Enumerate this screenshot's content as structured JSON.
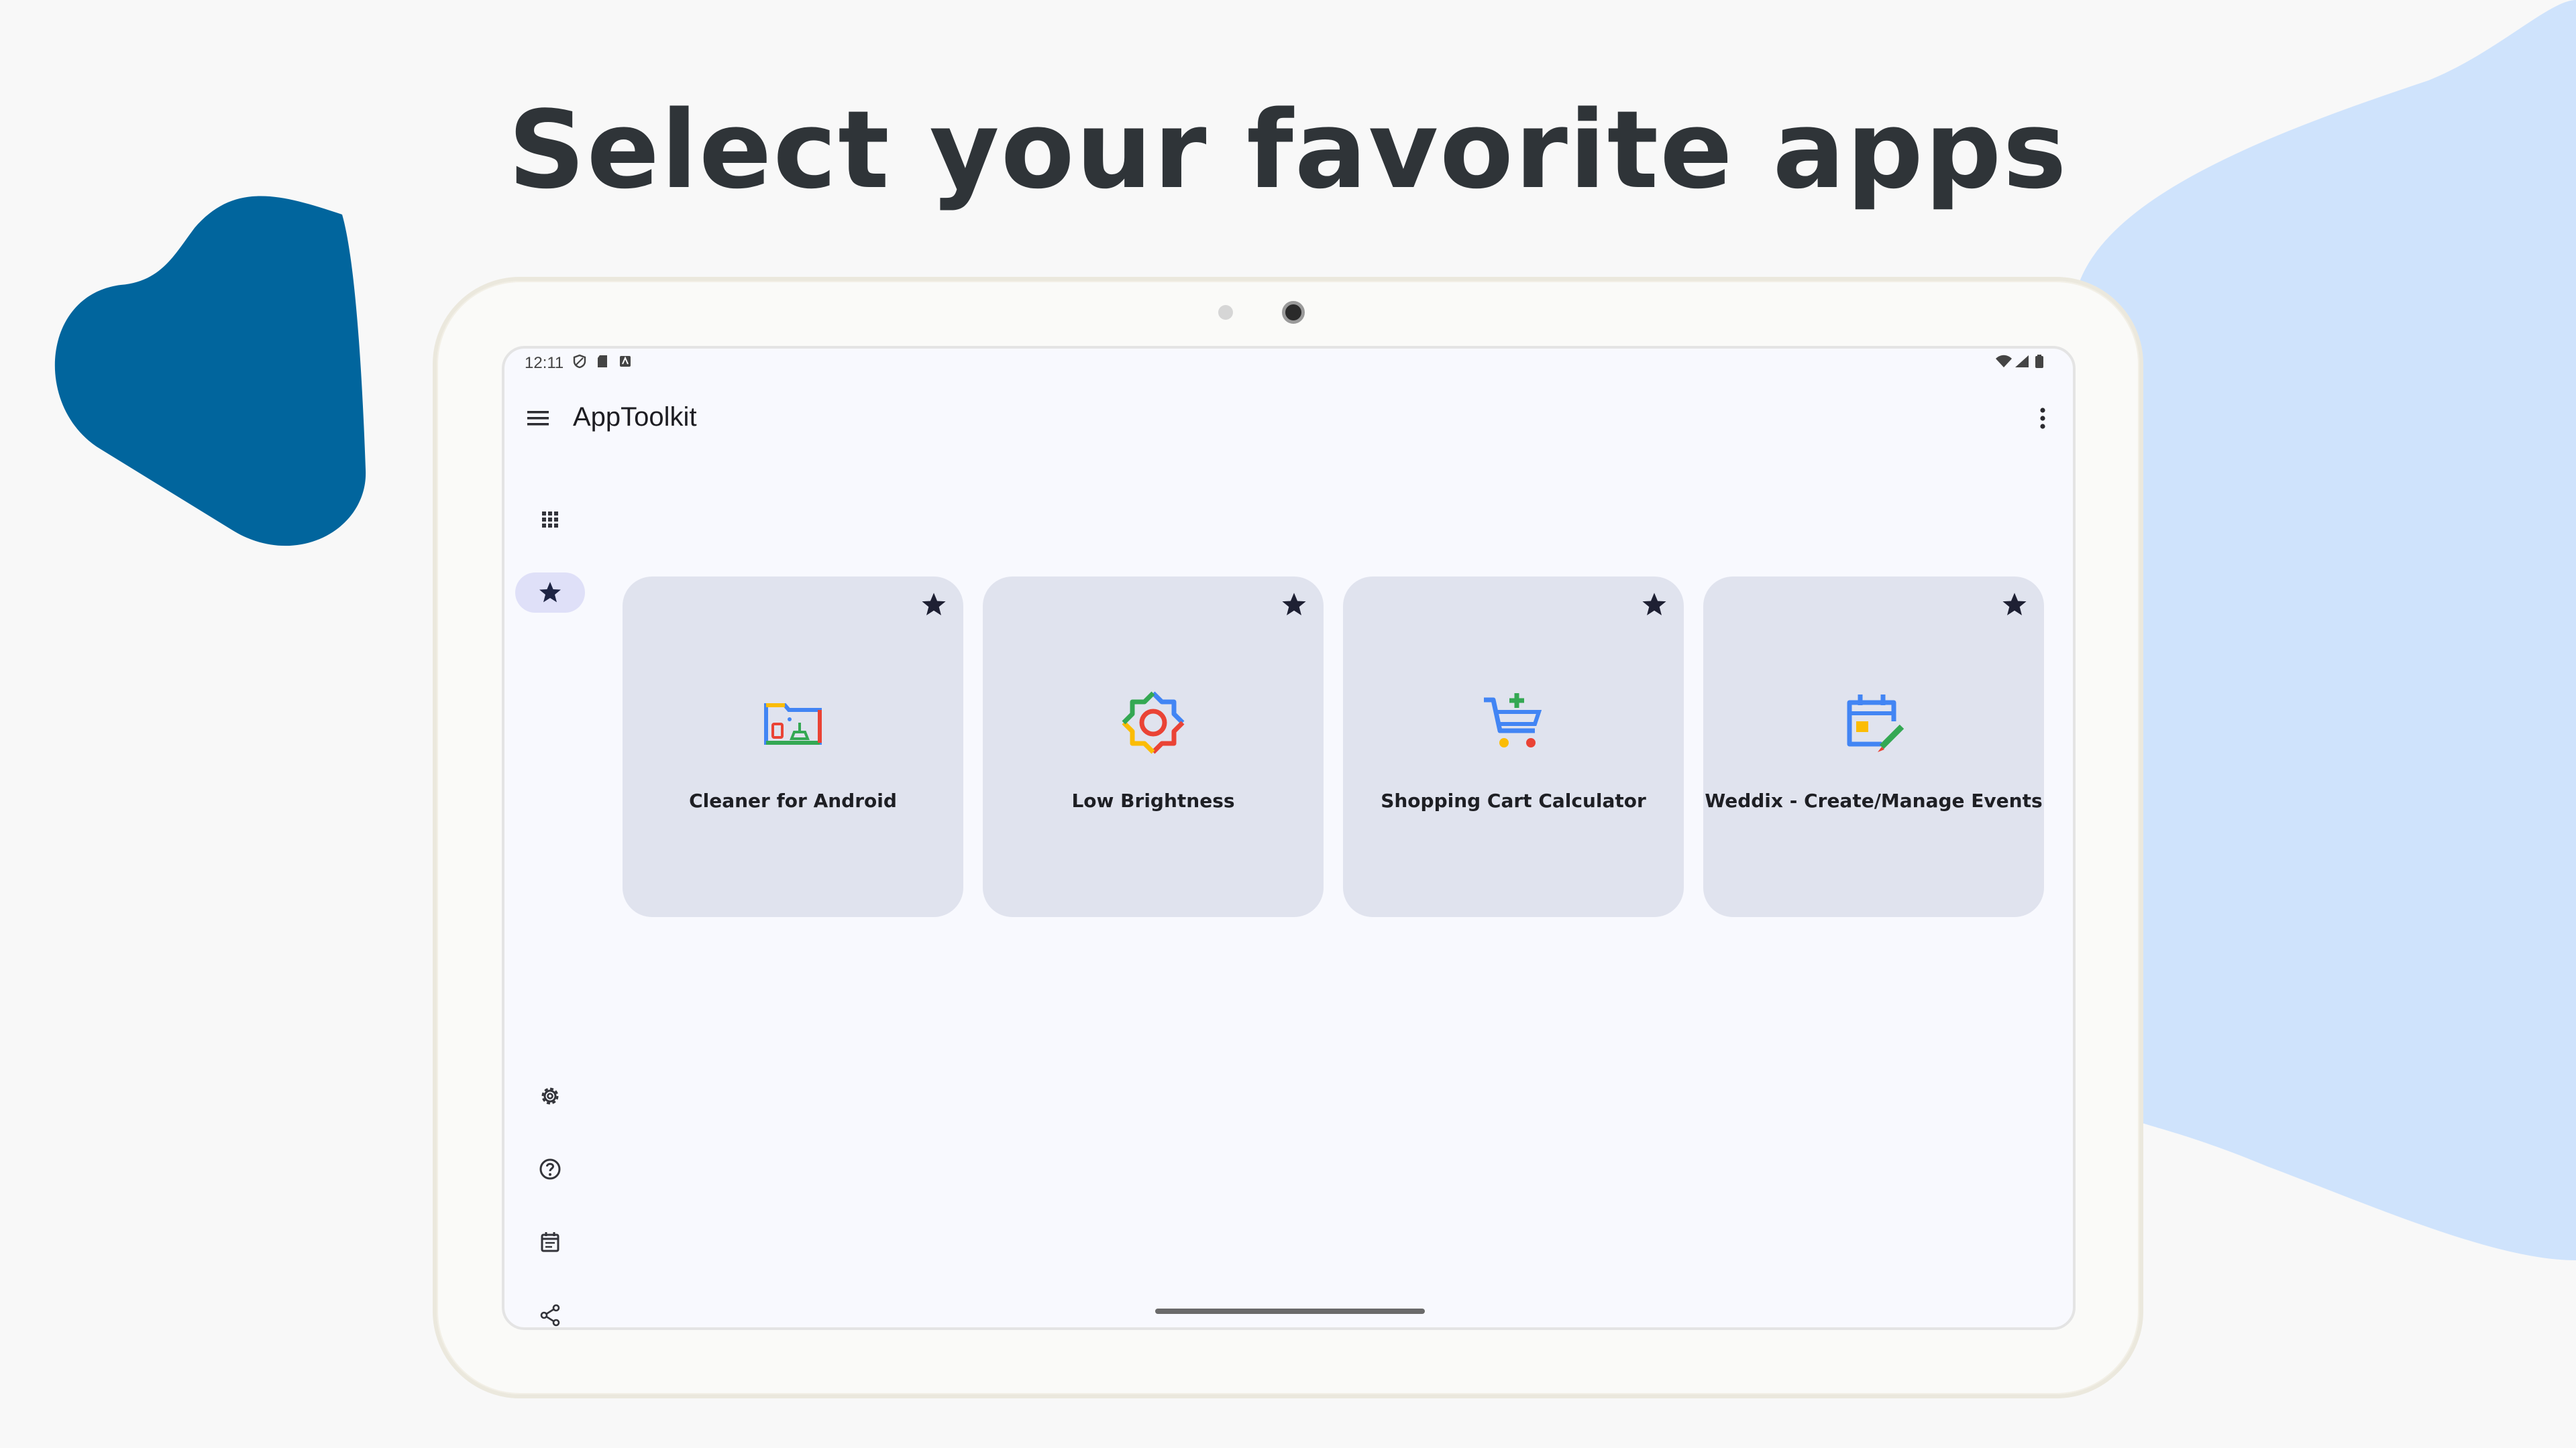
{
  "headline": "Select your favorite apps",
  "colors": {
    "background": "#f8f8f8",
    "blob_dark": "#01659d",
    "blob_light": "#cfe3fc",
    "card": "#e0e3ee",
    "rail_active": "#dfe0f8",
    "headline_text": "#2f3438"
  },
  "status_bar": {
    "time": "12:11",
    "left_icons": [
      "vpn-shield-icon",
      "sd-card-icon",
      "notification-icon"
    ],
    "right_icons": [
      "wifi-icon",
      "signal-icon",
      "battery-icon"
    ]
  },
  "app_bar": {
    "menu_icon": "hamburger-menu-icon",
    "title": "AppToolkit",
    "overflow_icon": "more-vert-icon"
  },
  "nav_rail": {
    "top_items": [
      {
        "icon": "apps-grid-icon",
        "active": false
      },
      {
        "icon": "star-icon",
        "active": true
      }
    ],
    "bottom_items": [
      {
        "icon": "settings-gear-icon"
      },
      {
        "icon": "help-circle-icon"
      },
      {
        "icon": "calendar-icon"
      },
      {
        "icon": "share-icon"
      }
    ]
  },
  "favorite_apps": [
    {
      "name": "Cleaner for Android",
      "icon": "cleaner-folder-icon",
      "favorited": true
    },
    {
      "name": "Low Brightness",
      "icon": "brightness-sun-icon",
      "favorited": true
    },
    {
      "name": "Shopping Cart Calculator",
      "icon": "shopping-cart-icon",
      "favorited": true
    },
    {
      "name": "Weddix - Create/Manage Events",
      "icon": "event-calendar-edit-icon",
      "favorited": true
    }
  ]
}
